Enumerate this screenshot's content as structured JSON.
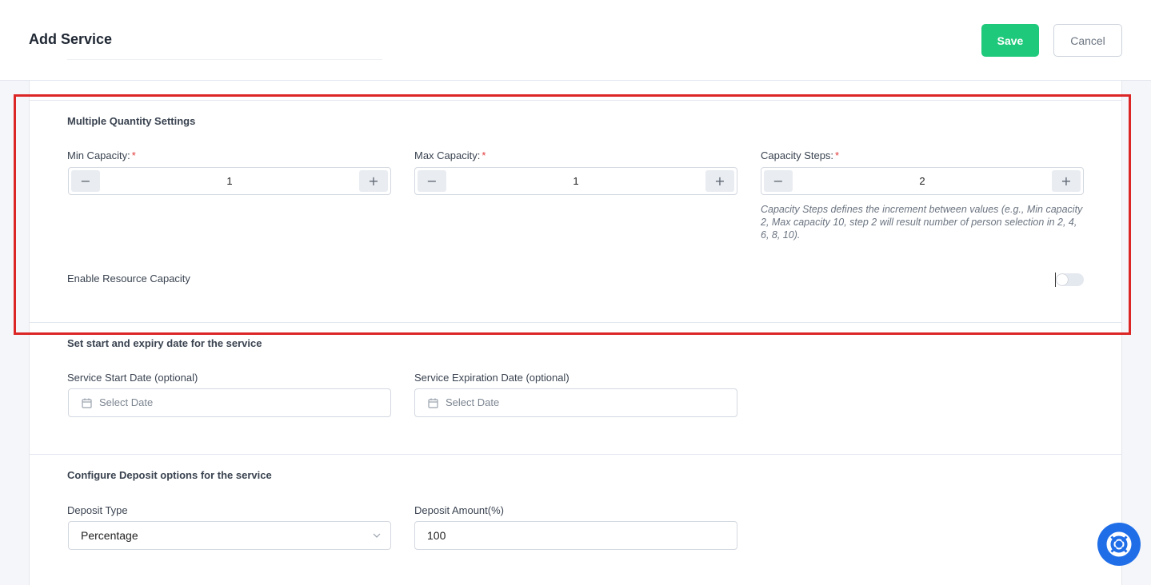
{
  "header": {
    "title": "Add Service",
    "save_label": "Save",
    "cancel_label": "Cancel"
  },
  "multiple_quantity": {
    "title": "Multiple Quantity Settings",
    "min_capacity": {
      "label": "Min Capacity:",
      "required_mark": "*",
      "value": "1"
    },
    "max_capacity": {
      "label": "Max Capacity:",
      "required_mark": "*",
      "value": "1"
    },
    "capacity_steps": {
      "label": "Capacity Steps:",
      "required_mark": "*",
      "value": "2"
    },
    "steps_hint": "Capacity Steps defines the increment between values (e.g., Min capacity 2, Max capacity 10, step 2 will result number of person selection in 2, 4, 6, 8, 10).",
    "minus_symbol": "−",
    "plus_symbol": "+",
    "enable_resource_capacity": {
      "label": "Enable Resource Capacity",
      "enabled": false
    }
  },
  "dates": {
    "title": "Set start and expiry date for the service",
    "start": {
      "label": "Service Start Date (optional)",
      "placeholder": "Select Date"
    },
    "expiry": {
      "label": "Service Expiration Date (optional)",
      "placeholder": "Select Date"
    }
  },
  "deposit": {
    "title": "Configure Deposit options for the service",
    "type": {
      "label": "Deposit Type",
      "selected": "Percentage"
    },
    "amount": {
      "label": "Deposit Amount(%)",
      "value": "100"
    }
  },
  "colors": {
    "save": "#1fc97b",
    "highlight": "#dc2626",
    "help_fab": "#1f6ee8",
    "required": "#e23b3b"
  },
  "icons": {
    "calendar": "calendar-icon",
    "chevron": "chevron-down-icon",
    "help": "lifebuoy-icon"
  }
}
